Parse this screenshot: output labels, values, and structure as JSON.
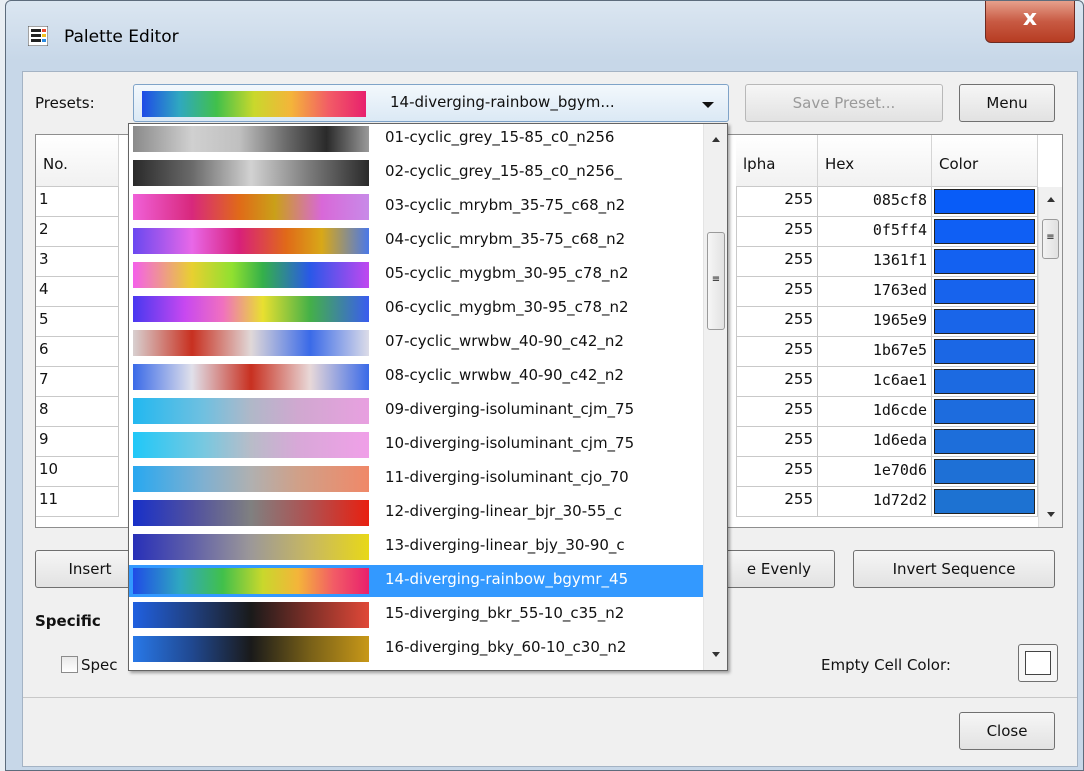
{
  "window": {
    "title": "Palette Editor",
    "close_glyph": "x"
  },
  "presets": {
    "label": "Presets:",
    "selected": "14-diverging-rainbow_bgym...",
    "selected_gradient": "linear-gradient(90deg,#1f4be6,#2fa8c0,#41c04b,#c9d82c,#f4b43a,#f25c66,#e8206d)",
    "save_label": "Save Preset...",
    "menu_label": "Menu"
  },
  "table": {
    "headers": {
      "no": "No.",
      "alpha": "lpha",
      "hex": "Hex",
      "color": "Color"
    },
    "rows": [
      {
        "no": "1",
        "alpha": "255",
        "hex": "085cf8",
        "color": "#085cf8"
      },
      {
        "no": "2",
        "alpha": "255",
        "hex": "0f5ff4",
        "color": "#0f5ff4"
      },
      {
        "no": "3",
        "alpha": "255",
        "hex": "1361f1",
        "color": "#1361f1"
      },
      {
        "no": "4",
        "alpha": "255",
        "hex": "1763ed",
        "color": "#1763ed"
      },
      {
        "no": "5",
        "alpha": "255",
        "hex": "1965e9",
        "color": "#1965e9"
      },
      {
        "no": "6",
        "alpha": "255",
        "hex": "1b67e5",
        "color": "#1b67e5"
      },
      {
        "no": "7",
        "alpha": "255",
        "hex": "1c6ae1",
        "color": "#1c6ae1"
      },
      {
        "no": "8",
        "alpha": "255",
        "hex": "1d6cde",
        "color": "#1d6cde"
      },
      {
        "no": "9",
        "alpha": "255",
        "hex": "1d6eda",
        "color": "#1d6eda"
      },
      {
        "no": "10",
        "alpha": "255",
        "hex": "1e70d6",
        "color": "#1e70d6"
      },
      {
        "no": "11",
        "alpha": "255",
        "hex": "1d72d2",
        "color": "#1d72d2"
      }
    ]
  },
  "buttons": {
    "insert": "Insert",
    "evenly": "e Evenly",
    "invert": "Invert Sequence",
    "close": "Close"
  },
  "specific": {
    "heading": "Specific",
    "checkbox_label": "Spec"
  },
  "empty_cell_label": "Empty Cell Color:",
  "dropdown": {
    "selected_index": 13,
    "options": [
      {
        "label": "01-cyclic_grey_15-85_c0_n256",
        "gradient": "linear-gradient(90deg,#8a8a8a,#d0d0d0 25%,#c0c0c0 45%,#6a6a6a 65%,#2a2a2a 82%,#9a9a9a)"
      },
      {
        "label": "02-cyclic_grey_15-85_c0_n256_",
        "gradient": "linear-gradient(90deg,#2a2a2a,#6a6a6a 25%,#d2d2d2 50%,#7a7a7a 75%,#2a2a2a)"
      },
      {
        "label": "03-cyclic_mrybm_35-75_c68_n2",
        "gradient": "linear-gradient(90deg,#f060d8,#d8287c 25%,#e06a18 45%,#caa018 60%,#d868d8 80%,#c88ae8)"
      },
      {
        "label": "04-cyclic_mrybm_35-75_c68_n2",
        "gradient": "linear-gradient(90deg,#6a48f0,#e868e8 25%,#d8207a 45%,#e06a18 65%,#d8a818 80%,#4a78e8)"
      },
      {
        "label": "05-cyclic_mygbm_30-95_c78_n2",
        "gradient": "linear-gradient(90deg,#f460ea,#e8d030 25%,#90e030 42%,#34b04a 55%,#2a58e8 75%,#c048f0)"
      },
      {
        "label": "06-cyclic_mygbm_30-95_c78_n2",
        "gradient": "linear-gradient(90deg,#4838f0,#c848f0 22%,#f070c0 38%,#e8e030 55%,#44b048 75%,#3a5cf0)"
      },
      {
        "label": "07-cyclic_wrwbw_40-90_c42_n2",
        "gradient": "linear-gradient(90deg,#d8d0d0,#c83020 25%,#e0d8d8 50%,#3a6ae8 75%,#dcdce8)"
      },
      {
        "label": "08-cyclic_wrwbw_40-90_c42_n2",
        "gradient": "linear-gradient(90deg,#3a6ae8,#e0e0ea 25%,#c83020 50%,#e8d8d8 75%,#3a6ae8)"
      },
      {
        "label": "09-diverging-isoluminant_cjm_75",
        "gradient": "linear-gradient(90deg,#22b8f0,#70c0e0 30%,#b0b8c8 50%,#d0a8d0 70%,#e8a0e0)"
      },
      {
        "label": "10-diverging-isoluminant_cjm_75",
        "gradient": "linear-gradient(90deg,#20c8f8,#78c8e0 30%,#b8bcc8 50%,#d8a8d8 70%,#f0a0e8)"
      },
      {
        "label": "11-diverging-isoluminant_cjo_70",
        "gradient": "linear-gradient(90deg,#28a8f0,#80b0d0 30%,#b0b0b0 50%,#d0a088 70%,#f08868)"
      },
      {
        "label": "12-diverging-linear_bjr_30-55_c",
        "gradient": "linear-gradient(90deg,#1830c8,#5050a0 25%,#808080 50%,#b05050 75%,#e82010)"
      },
      {
        "label": "13-diverging-linear_bjy_30-90_c",
        "gradient": "linear-gradient(90deg,#2830b8,#6060a8 25%,#9c9898 50%,#c8b860 75%,#e8d818)"
      },
      {
        "label": "14-diverging-rainbow_bgymr_45",
        "gradient": "linear-gradient(90deg,#1f4be6,#2fa8c0 20%,#41c04b 38%,#c9d82c 55%,#f4b43a 70%,#f25c66 85%,#e8206d)"
      },
      {
        "label": "15-diverging_bkr_55-10_c35_n2",
        "gradient": "linear-gradient(90deg,#2060e0,#204080 25%,#1a1a1a 50%,#803028 75%,#e04838)"
      },
      {
        "label": "16-diverging_bky_60-10_c30_n2",
        "gradient": "linear-gradient(90deg,#2878e8,#204890 25%,#1a1a1a 50%,#786018 75%,#c89818)"
      }
    ]
  }
}
